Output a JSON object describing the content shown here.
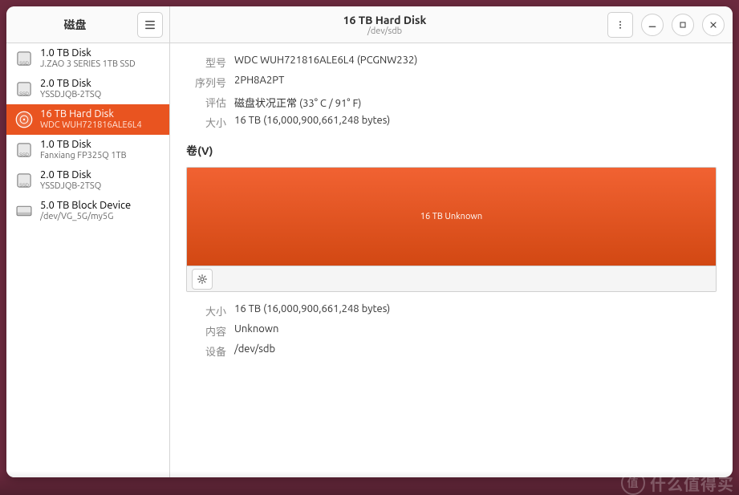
{
  "header": {
    "app_title": "磁盘",
    "disk_title": "16 TB Hard Disk",
    "disk_subtitle": "/dev/sdb"
  },
  "sidebar": {
    "items": [
      {
        "name": "1.0 TB Disk",
        "model": "J.ZAO 3 SERIES 1TB SSD",
        "icon": "ssd"
      },
      {
        "name": "2.0 TB Disk",
        "model": "YSSDJQB-2TSQ",
        "icon": "ssd"
      },
      {
        "name": "16 TB Hard Disk",
        "model": "WDC  WUH721816ALE6L4",
        "icon": "hdd",
        "selected": true
      },
      {
        "name": "1.0 TB Disk",
        "model": "Fanxiang FP325Q  1TB",
        "icon": "ssd"
      },
      {
        "name": "2.0 TB Disk",
        "model": "YSSDJQB-2TSQ",
        "icon": "ssd"
      },
      {
        "name": "5.0 TB Block Device",
        "model": "/dev/VG_5G/my5G",
        "icon": "block"
      }
    ]
  },
  "details": {
    "labels": {
      "model": "型号",
      "serial": "序列号",
      "assessment": "评估",
      "size": "大小"
    },
    "model": "WDC  WUH721816ALE6L4 (PCGNW232)",
    "serial": "2PH8A2PT",
    "assessment": "磁盘状况正常 (33° C / 91° F)",
    "size": "16 TB (16,000,900,661,248 bytes)"
  },
  "volumes": {
    "section_title": "卷(V)",
    "bar_label": "16 TB Unknown",
    "labels": {
      "size": "大小",
      "contents": "内容",
      "device": "设备"
    },
    "size": "16 TB (16,000,900,661,248 bytes)",
    "contents": "Unknown",
    "device": "/dev/sdb"
  },
  "watermark": {
    "badge": "值",
    "text": "什么值得买"
  }
}
